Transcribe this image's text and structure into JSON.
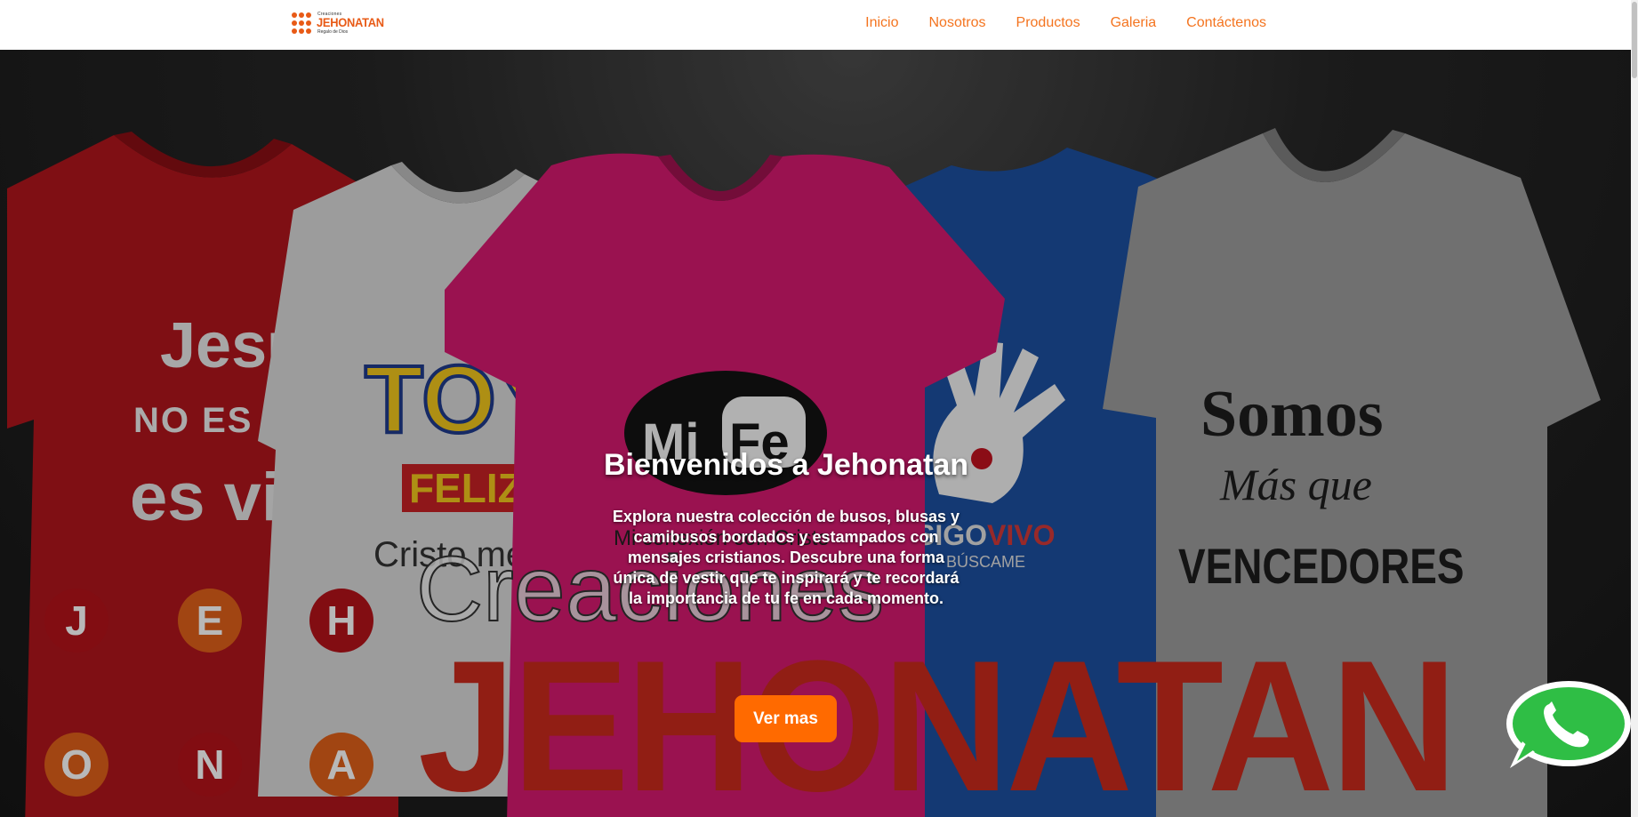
{
  "logo": {
    "top_text": "Creaciones",
    "main_text": "JEHONATAN",
    "sub_text": "Regalo de Dios"
  },
  "nav": {
    "items": [
      "Inicio",
      "Nosotros",
      "Productos",
      "Galeria",
      "Contáctenos"
    ]
  },
  "hero": {
    "title": "Bienvenidos a Jehonatan",
    "description": "Explora nuestra colección de busos, blusas y camibusos bordados y estampados con mensajes cristianos. Descubre una forma única de vestir que te inspirará y te recordará la importancia de tu fe en cada momento.",
    "button_label": "Ver mas"
  },
  "banner": {
    "shirt1_lines": [
      "Jesú",
      "NO ES RE",
      "es vida"
    ],
    "shirt2_lines": [
      "TOY",
      "FELIZ",
      "Cristo me Ama"
    ],
    "shirt3_lines": [
      "Mi",
      "Fe",
      "Mi conexión con Cristo"
    ],
    "shirt4_lines": [
      "SIGO",
      "VIVO",
      "BÚSCAME"
    ],
    "shirt5_lines": [
      "Somos",
      "Más que",
      "VENCEDORES"
    ],
    "circle_letters": [
      "J",
      "E",
      "H",
      "O",
      "N",
      "A"
    ],
    "brand_small": "Creaciones",
    "brand_big": "JEHONATAN"
  },
  "colors": {
    "accent": "#ff6a00",
    "nav_link": "#f4741f"
  },
  "icons": {
    "whatsapp": "whatsapp-icon"
  }
}
